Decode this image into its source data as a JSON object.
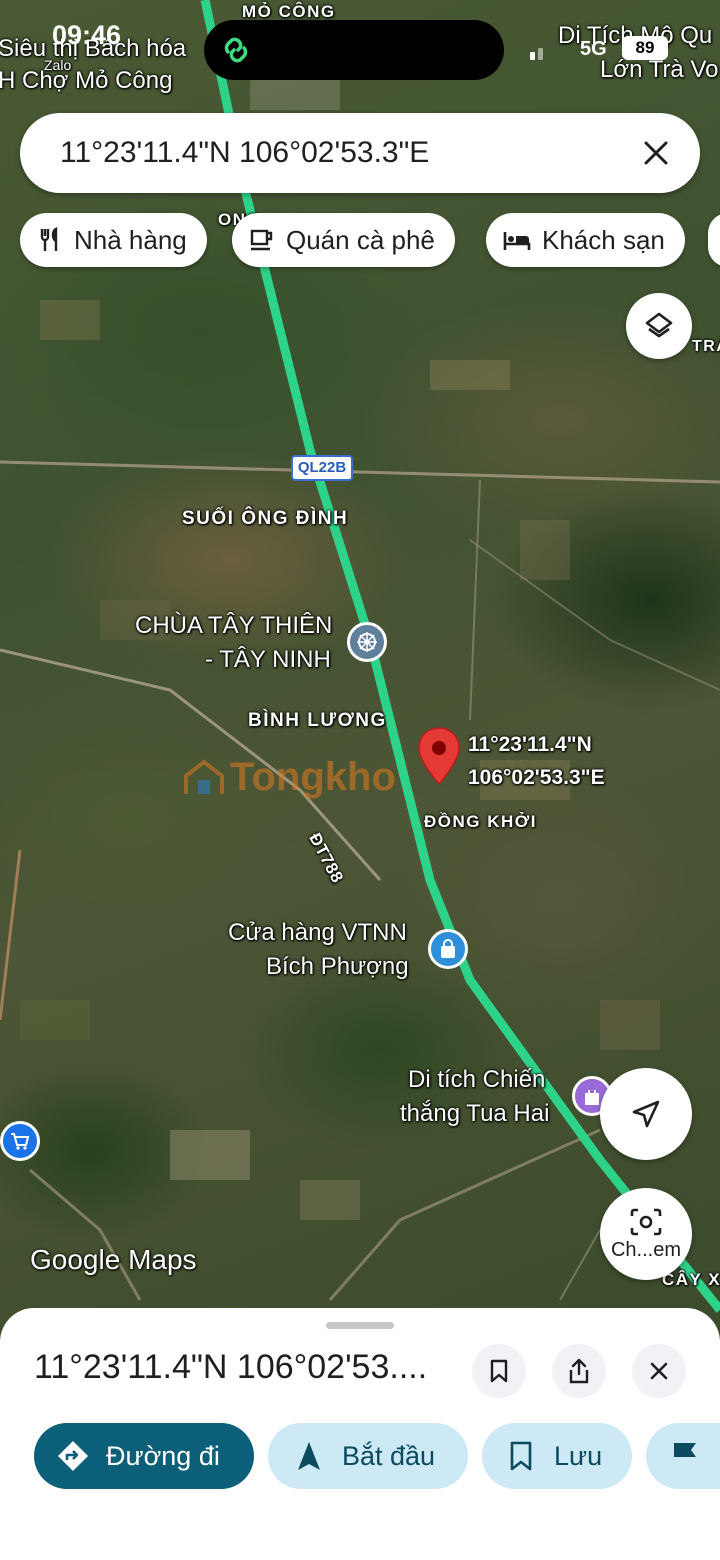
{
  "status_bar": {
    "time": "09:46",
    "network": "5G",
    "battery": "89"
  },
  "search": {
    "query": "11°23'11.4\"N 106°02'53.3\"E"
  },
  "chips": [
    {
      "label": "Nhà hàng",
      "icon": "restaurant-icon"
    },
    {
      "label": "Quán cà phê",
      "icon": "coffee-icon"
    },
    {
      "label": "Khách sạn",
      "icon": "hotel-icon"
    }
  ],
  "map": {
    "labels": {
      "mo_cong": "MỎ CÔNG",
      "sieu_thi_line1": "Siêu thị Bách hóa",
      "sieu_thi_line2": "H Chợ Mỏ Công",
      "zalo": "Zalo",
      "di_tich_line1": "Di Tích Mộ Qu",
      "di_tich_line2": "Lớn Trà Vo",
      "ong_partial": "ONG",
      "tra_partial": "TRÀ",
      "road_shield": "QL22B",
      "suoi_ong_dinh": "SUỐI ÔNG ĐÌNH",
      "chua_line1": "CHÙA TÂY THIÊN",
      "chua_line2": "- TÂY NINH",
      "binh_luong": "BÌNH LƯƠNG",
      "pin_line1": "11°23'11.4\"N",
      "pin_line2": "106°02'53.3\"E",
      "dong_khoi": "ĐỒNG KHỞI",
      "dt788": "ĐT788",
      "cua_hang_line1": "Cửa hàng VTNN",
      "cua_hang_line2": "Bích Phượng",
      "chien_thang_line1": "Di tích Chiến",
      "chien_thang_line2": "thắng Tua Hai",
      "cay_partial": "CÂY X",
      "watermark": "Tongkho",
      "google_logo_google": "Google",
      "google_logo_maps": "Maps",
      "lens_label": "Ch...em"
    },
    "colors": {
      "route": "#2ed38a",
      "pin": "#e53935",
      "accent": "#0b5f78"
    }
  },
  "sheet": {
    "title": "11°23'11.4\"N 106°02'53....",
    "actions": [
      {
        "label": "Đường đi",
        "icon": "directions-icon"
      },
      {
        "label": "Bắt đầu",
        "icon": "navigation-icon"
      },
      {
        "label": "Lưu",
        "icon": "bookmark-icon"
      }
    ]
  }
}
